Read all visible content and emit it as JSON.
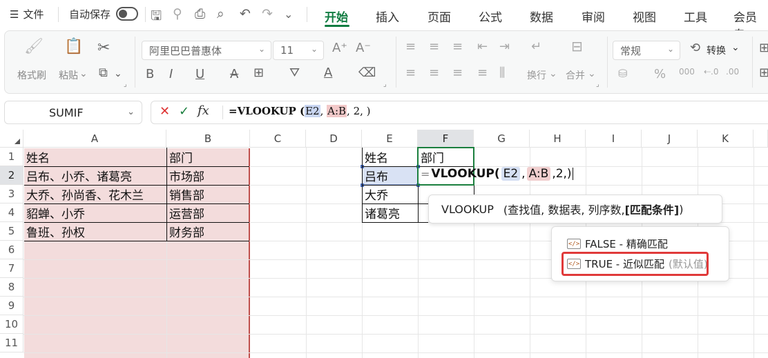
{
  "menubar": {
    "file_label": "文件",
    "autosave_label": "自动保存",
    "tabs": [
      "开始",
      "插入",
      "页面",
      "公式",
      "数据",
      "审阅",
      "视图",
      "工具",
      "会员专"
    ]
  },
  "ribbon": {
    "format_painter": "格式刷",
    "paste": "粘贴",
    "font_name": "阿里巴巴普惠体",
    "font_size": "11",
    "wrap": "换行",
    "merge": "合并",
    "number_format": "常规",
    "convert": "转换"
  },
  "formula_bar": {
    "name_box": "SUMIF",
    "fx": "fx",
    "formula_prefix": "=VLOOKUP (",
    "ref1": "E2",
    "ref2": "A:B",
    "formula_suffix": ", 2, )"
  },
  "grid": {
    "columns": [
      "A",
      "B",
      "C",
      "D",
      "E",
      "F",
      "G",
      "H",
      "I",
      "J",
      "K"
    ],
    "rows": [
      "1",
      "2",
      "3",
      "4",
      "5",
      "6",
      "7",
      "8",
      "9",
      "10",
      "11"
    ],
    "table_a": [
      [
        "姓名",
        "部门"
      ],
      [
        "吕布、小乔、诸葛亮",
        "市场部"
      ],
      [
        "大乔、孙尚香、花木兰",
        "销售部"
      ],
      [
        "貂蝉、小乔",
        "运营部"
      ],
      [
        "鲁班、孙权",
        "财务部"
      ]
    ],
    "lookup_e": [
      "姓名",
      "吕布",
      "大乔",
      "诸葛亮"
    ],
    "lookup_f_header": "部门",
    "edit_cell": {
      "eq": "=",
      "fn": "VLOOKUP(",
      "ref1": "E2",
      "comma1": ",",
      "ref2": "A:B",
      "rest": ",2,)"
    }
  },
  "tooltip": {
    "fn": "VLOOKUP",
    "args": "(查找值, 数据表, 列序数, ",
    "current_arg": "[匹配条件]",
    "close": ")"
  },
  "dropdown": {
    "options": [
      {
        "label": "FALSE - 精确匹配",
        "hint": ""
      },
      {
        "label": "TRUE - 近似匹配",
        "hint": "(默认值)"
      }
    ]
  }
}
